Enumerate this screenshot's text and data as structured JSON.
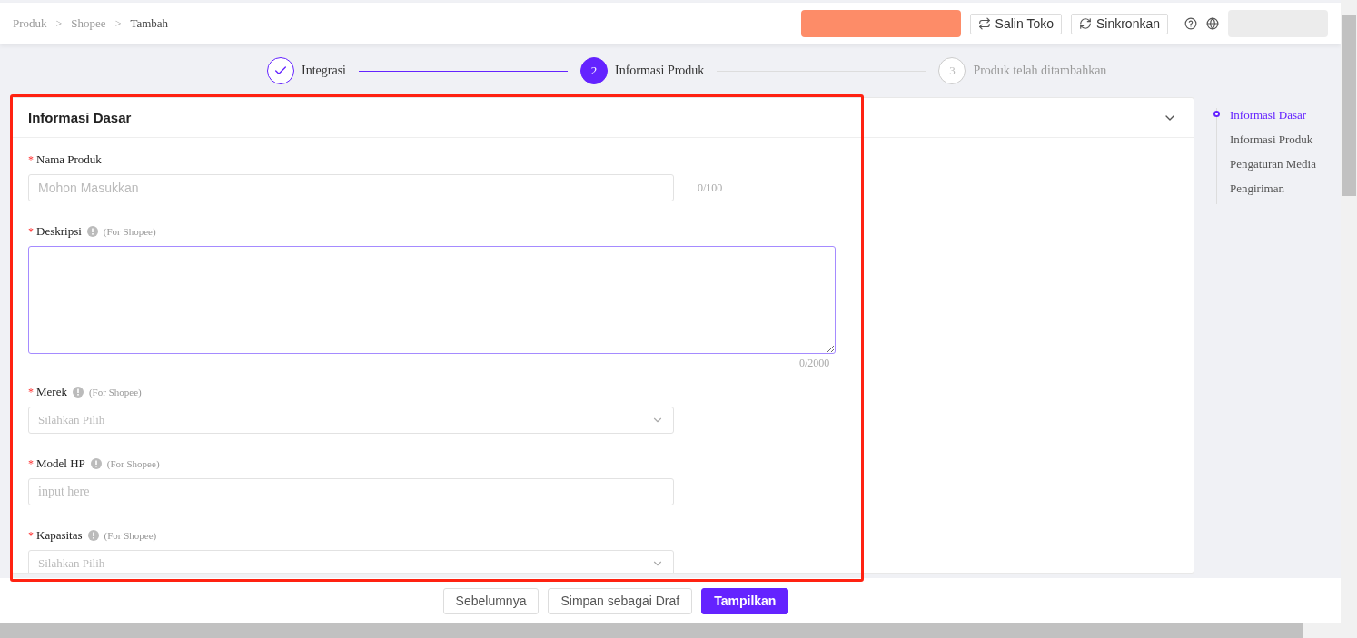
{
  "breadcrumb_separator": ">",
  "breadcrumb": [
    {
      "label": "Produk",
      "current": false
    },
    {
      "label": "Shopee",
      "current": false
    },
    {
      "label": "Tambah",
      "current": true
    }
  ],
  "header_buttons": [
    {
      "label": "Salin Toko",
      "kind": "copy"
    },
    {
      "label": "Sinkronkan",
      "kind": "sync"
    }
  ],
  "steps": [
    {
      "label": "Integrasi",
      "completed": true,
      "current": false
    },
    {
      "number": "2",
      "label": "Informasi Produk",
      "completed": false,
      "current": true
    },
    {
      "number": "3",
      "label": "Produk telah ditambahkan",
      "completed": false,
      "current": false
    }
  ],
  "section": {
    "title": "Informasi Dasar",
    "expanded": true,
    "fields": [
      {
        "kind": "text",
        "label": "Nama Produk",
        "required_mark": "*",
        "placeholder": "Mohon Masukkan",
        "counter": "0/100"
      },
      {
        "kind": "textarea",
        "label": "Deskripsi",
        "required_mark": "*",
        "note": "(For Shopee)",
        "counter": "0/2000",
        "focused": true
      },
      {
        "kind": "select",
        "label": "Merek",
        "required_mark": "*",
        "note": "(For Shopee)",
        "placeholder": "Silahkan Pilih"
      },
      {
        "kind": "text",
        "label": "Model HP",
        "required_mark": "*",
        "note": "(For Shopee)",
        "placeholder": "input here"
      },
      {
        "kind": "select",
        "label": "Kapasitas",
        "required_mark": "*",
        "note": "(For Shopee)",
        "placeholder": "Silahkan Pilih"
      }
    ]
  },
  "anchor_nav": [
    {
      "label": "Informasi Dasar",
      "selected": true
    },
    {
      "label": "Informasi Produk",
      "selected": false
    },
    {
      "label": "Pengaturan Media",
      "selected": false
    },
    {
      "label": "Pengiriman",
      "selected": false
    }
  ],
  "footer_buttons": [
    {
      "label": "Sebelumnya",
      "primary": false
    },
    {
      "label": "Simpan sebagai Draf",
      "primary": false
    },
    {
      "label": "Tampilkan",
      "primary": true
    }
  ]
}
